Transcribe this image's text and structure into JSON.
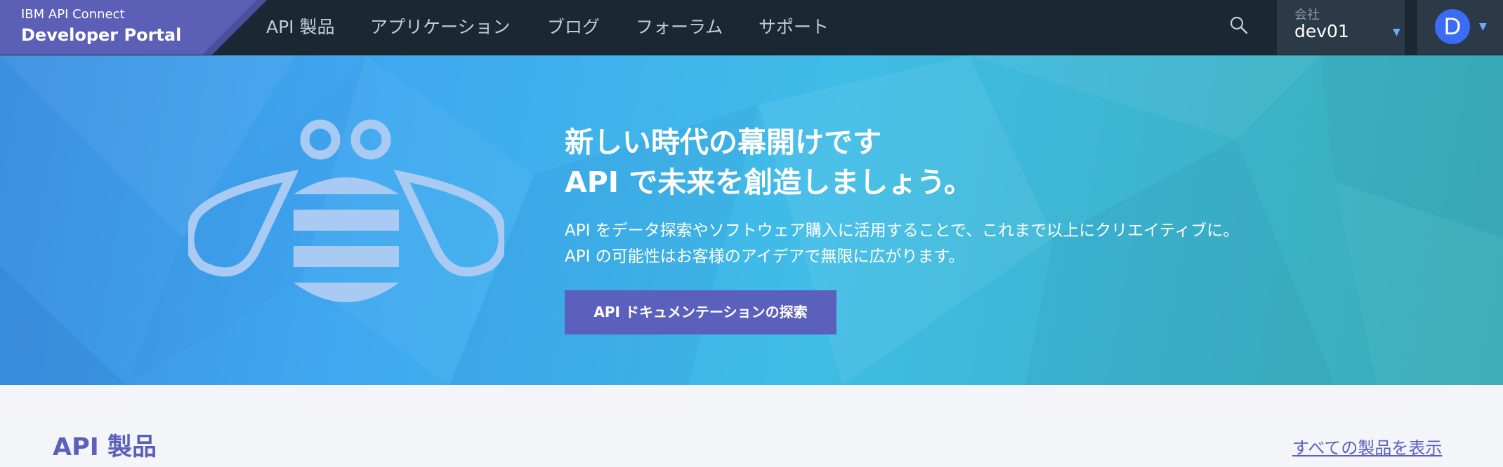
{
  "brand": {
    "line1": "IBM API Connect",
    "line2": "Developer Portal"
  },
  "nav": {
    "items": [
      {
        "label": "API 製品"
      },
      {
        "label": "アプリケーション"
      },
      {
        "label": "ブログ"
      },
      {
        "label": "フォーラム"
      },
      {
        "label": "サポート"
      }
    ]
  },
  "icons": {
    "search": "search-icon",
    "org_caret": "caret-down-icon",
    "user_caret": "caret-down-icon",
    "hero_art": "bee-icon"
  },
  "org": {
    "label": "会社",
    "value": "dev01",
    "caret": "▼"
  },
  "user": {
    "initial": "D",
    "caret": "▼"
  },
  "hero": {
    "title_line1": "新しい時代の幕開けです",
    "title_line2": "API で未来を創造しましょう。",
    "desc_line1": "API をデータ探索やソフトウェア購入に活用することで、これまで以上にクリエイティブに。",
    "desc_line2": "API の可能性はお客様のアイデアで無限に広がります。",
    "cta_label": "API ドキュメンテーションの探索"
  },
  "products_section": {
    "title": "API 製品",
    "view_all_label": "すべての製品を表示"
  },
  "colors": {
    "topbar": "#1b2834",
    "brand_panel": "#5b5fb6",
    "accent": "#5b60bd",
    "avatar": "#3a6cf4",
    "hero_start": "#3d8fe0",
    "hero_end": "#38abb6"
  }
}
